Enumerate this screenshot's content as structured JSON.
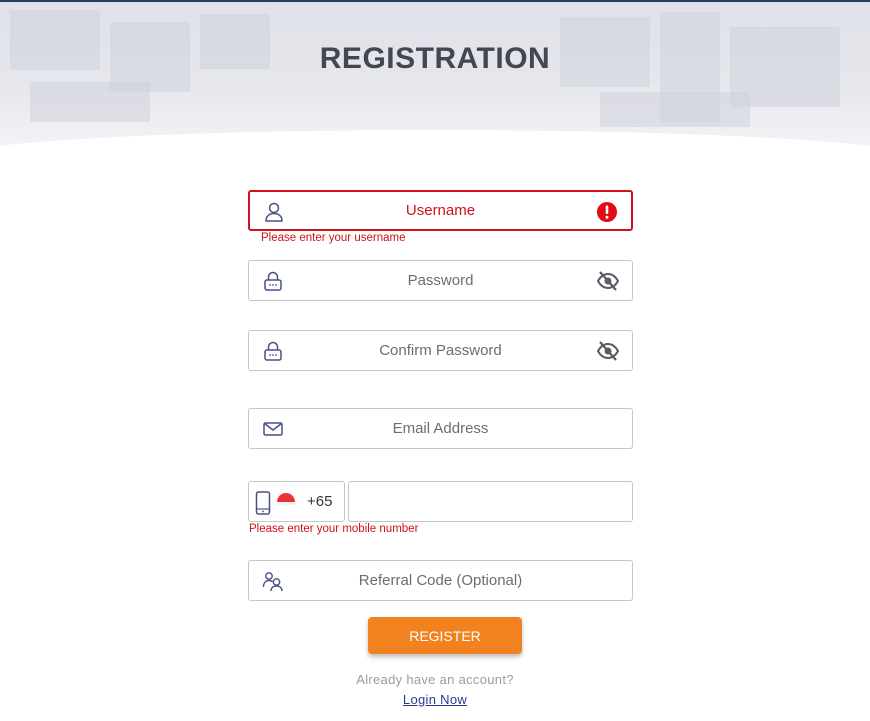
{
  "page": {
    "title": "REGISTRATION"
  },
  "form": {
    "username": {
      "placeholder": "Username",
      "error": "Please enter your username",
      "icon": "user-icon",
      "status_icon": "error-icon"
    },
    "password": {
      "placeholder": "Password",
      "icon": "lock-icon",
      "toggle_icon": "eye-off-icon"
    },
    "confirm_password": {
      "placeholder": "Confirm Password",
      "icon": "lock-icon",
      "toggle_icon": "eye-off-icon"
    },
    "email": {
      "placeholder": "Email Address",
      "icon": "mail-icon"
    },
    "mobile": {
      "country_code": "+65",
      "country_flag": "singapore-flag-icon",
      "icon": "mobile-phone-icon",
      "value": "",
      "error": "Please enter your mobile number"
    },
    "referral": {
      "placeholder": "Referral Code (Optional)",
      "icon": "users-icon"
    },
    "submit_label": "REGISTER"
  },
  "footer": {
    "already_text": "Already have an account?",
    "login_link": "Login Now"
  },
  "colors": {
    "accent": "#f2821f",
    "error": "#d0121b",
    "icon": "#4a4f86",
    "link": "#2b3a9a"
  }
}
